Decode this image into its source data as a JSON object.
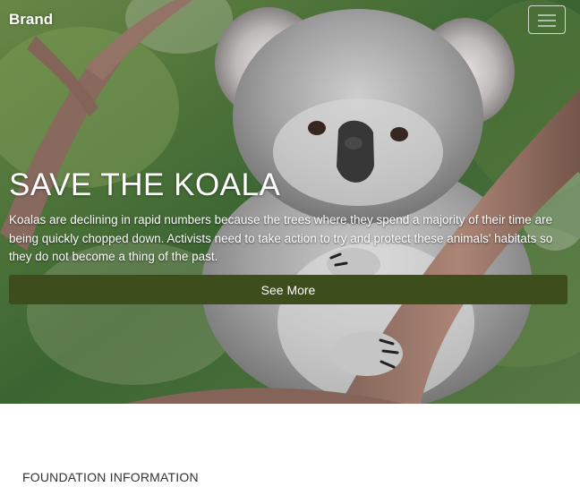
{
  "navbar": {
    "brand": "Brand",
    "toggler_icon": "hamburger-icon"
  },
  "hero": {
    "image": "koala-photo",
    "title": "SAVE THE KOALA",
    "description": "Koalas are declining in rapid numbers because the trees where they spend a majority of their time are being quickly chopped down. Activists need to take action to try and protect these animals' habitats so they do not become a thing of the past.",
    "button_label": "See More",
    "button_color": "#3d4d1c"
  },
  "sections": {
    "foundation_title": "FOUNDATION INFORMATION"
  }
}
